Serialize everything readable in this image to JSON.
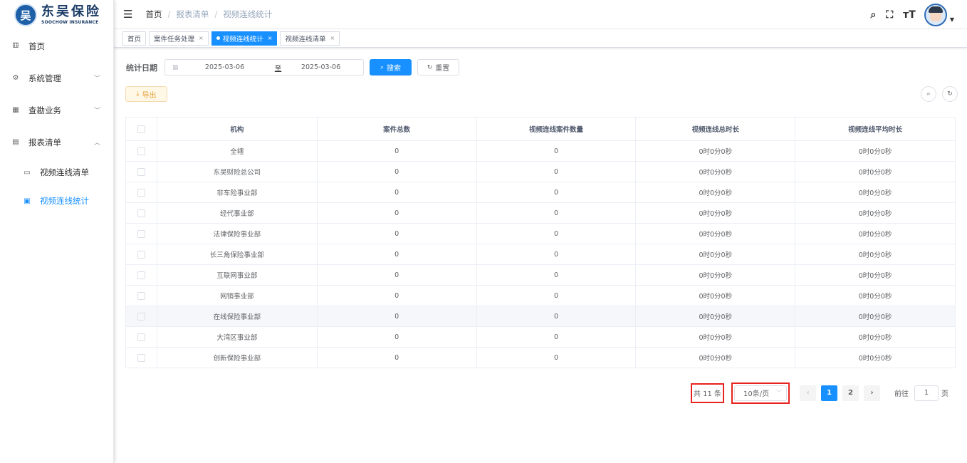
{
  "logo": {
    "mark": "吴",
    "cn": "东吴保险",
    "en": "SOOCHOW INSURANCE"
  },
  "sidebar": {
    "items": [
      {
        "label": "首页",
        "icon": "dashboard-icon",
        "glyph": "⚅",
        "arrow": ""
      },
      {
        "label": "系统管理",
        "icon": "gear-icon",
        "glyph": "⚙",
        "arrow": "﹀"
      },
      {
        "label": "查勘业务",
        "icon": "table-icon",
        "glyph": "▦",
        "arrow": "﹀"
      },
      {
        "label": "报表清单",
        "icon": "report-icon",
        "glyph": "▤",
        "arrow": "︿"
      }
    ],
    "sub_items": [
      {
        "label": "视频连线清单",
        "icon": "monitor-icon",
        "glyph": "▭"
      },
      {
        "label": "视频连线统计",
        "icon": "chart-icon",
        "glyph": "▣"
      }
    ]
  },
  "header": {
    "breadcrumb": [
      "首页",
      "报表清单",
      "视频连线统计"
    ],
    "separator": "/"
  },
  "tags": [
    {
      "label": "首页",
      "closable": false
    },
    {
      "label": "案件任务处理",
      "closable": true
    },
    {
      "label": "视频连线统计",
      "closable": true,
      "active": true
    },
    {
      "label": "视频连线清单",
      "closable": true
    }
  ],
  "tag_close": "×",
  "search": {
    "label": "统计日期",
    "start_date": "2025-03-06",
    "range_separator": "至",
    "end_date": "2025-03-06",
    "search_button": "搜索",
    "reset_button": "重置"
  },
  "toolbar": {
    "export_button": "导出"
  },
  "table": {
    "columns": [
      "机构",
      "案件总数",
      "视频连线案件数量",
      "视频连线总时长",
      "视频连线平均时长"
    ],
    "rows": [
      [
        "全辖",
        "0",
        "0",
        "0时0分0秒",
        "0时0分0秒"
      ],
      [
        "东吴财险总公司",
        "0",
        "0",
        "0时0分0秒",
        "0时0分0秒"
      ],
      [
        "非车险事业部",
        "0",
        "0",
        "0时0分0秒",
        "0时0分0秒"
      ],
      [
        "经代事业部",
        "0",
        "0",
        "0时0分0秒",
        "0时0分0秒"
      ],
      [
        "法律保险事业部",
        "0",
        "0",
        "0时0分0秒",
        "0时0分0秒"
      ],
      [
        "长三角保险事业部",
        "0",
        "0",
        "0时0分0秒",
        "0时0分0秒"
      ],
      [
        "互联网事业部",
        "0",
        "0",
        "0时0分0秒",
        "0时0分0秒"
      ],
      [
        "网销事业部",
        "0",
        "0",
        "0时0分0秒",
        "0时0分0秒"
      ],
      [
        "在线保险事业部",
        "0",
        "0",
        "0时0分0秒",
        "0时0分0秒"
      ],
      [
        "大湾区事业部",
        "0",
        "0",
        "0时0分0秒",
        "0时0分0秒"
      ],
      [
        "创新保险事业部",
        "0",
        "0",
        "0时0分0秒",
        "0时0分0秒"
      ]
    ]
  },
  "pagination": {
    "total": "共 11 条",
    "page_size": "10条/页",
    "pages": [
      "1",
      "2"
    ],
    "current_page": "1",
    "goto_prefix": "前往",
    "goto_value": "1",
    "goto_suffix": "页"
  },
  "colors": {
    "primary": "#1890ff",
    "highlight_box": "#e8231f",
    "warning": "#e6a23c"
  }
}
